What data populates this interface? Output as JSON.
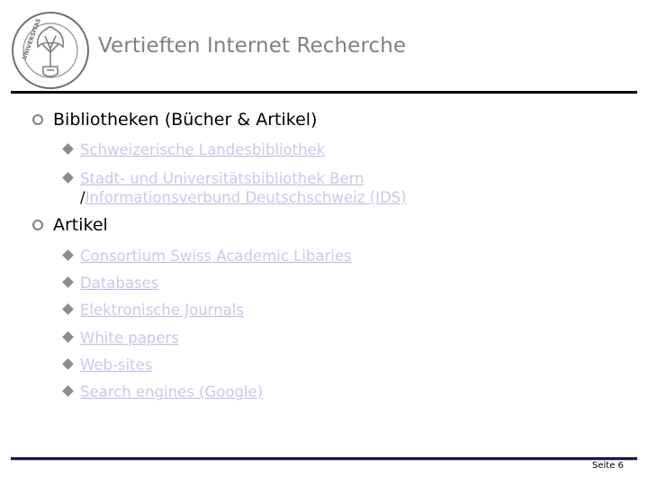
{
  "header": {
    "logo_alt": "Universitas Bernensis seal",
    "logo_text_left": "UNIVERSITAS",
    "logo_text_right": "BERNENSIS",
    "title": "Vertieften Internet Recherche"
  },
  "sections": [
    {
      "heading": "Bibliotheken (Bücher & Artikel)",
      "items": [
        {
          "label": "Schweizerische Landesbibliothek"
        },
        {
          "label": "Stadt- und Universitätsbibliothek Bern",
          "separator": "/",
          "label2": "Informationsverbund Deutschschweiz (IDS)"
        }
      ]
    },
    {
      "heading": "Artikel",
      "items": [
        {
          "label": "Consortium Swiss Academic Libaries"
        },
        {
          "label": "Databases"
        },
        {
          "label": "Elektronische Journals"
        },
        {
          "label": "White papers"
        },
        {
          "label": "Web-sites"
        },
        {
          "label": "Search engines (Google)"
        }
      ]
    }
  ],
  "footer": {
    "page_label": "Seite 6"
  },
  "colors": {
    "title": "#808080",
    "link": "#c8c8ec",
    "bullet": "#8c8c8c",
    "rule": "#000000"
  }
}
